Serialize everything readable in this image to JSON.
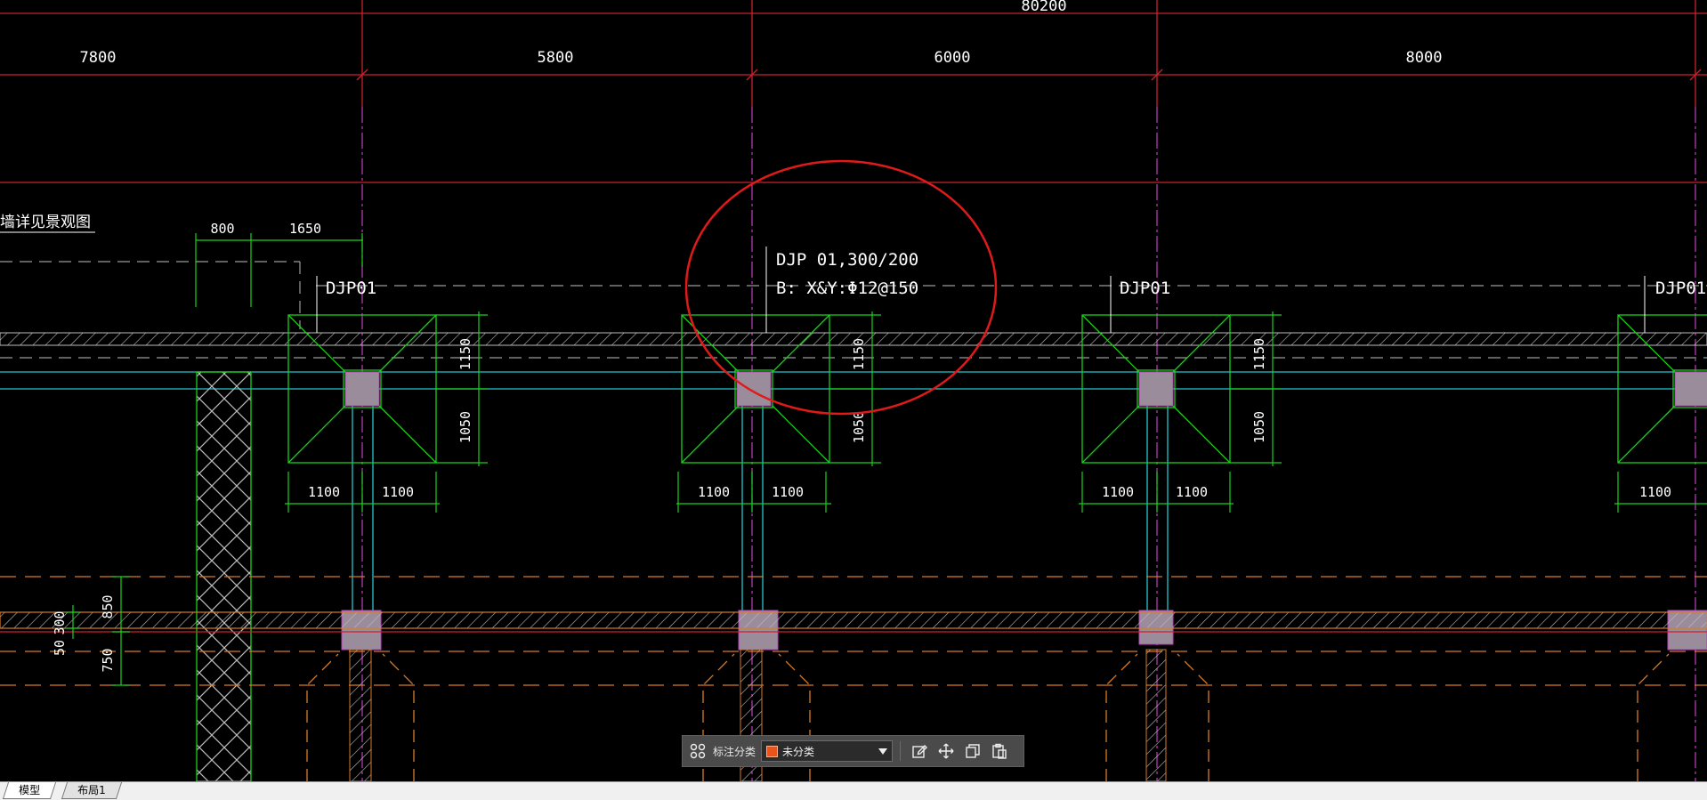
{
  "drawing": {
    "overall_dim": "80200",
    "bay_dims": [
      "7800",
      "5800",
      "6000",
      "8000"
    ],
    "note_text": "墙详见景观图",
    "top_dims": [
      "800",
      "1650"
    ],
    "footing_label": "DJP01",
    "footing_dims": {
      "upper": "1150",
      "lower": "1050",
      "left": "1100",
      "right": "1100"
    },
    "left_dims": [
      "850",
      "300",
      "50",
      "750"
    ],
    "callout_line1": "DJP 01,300/200",
    "callout_line2": "B: X&Y:Φ12@150",
    "colors": {
      "axis": "#c8232c",
      "green": "#19d219",
      "cyan": "#22c8d0",
      "orange": "#d87a28",
      "magenta": "#c040c0",
      "column": "#9a8c9a"
    }
  },
  "toolbar": {
    "grid_icon": "grid-icon",
    "category_label": "标注分类",
    "category_value": "未分类",
    "edit_icon": "edit-icon",
    "move_icon": "move-icon",
    "copy_icon": "copy-icon",
    "paste_icon": "paste-icon"
  },
  "tabs": {
    "model": "模型",
    "layout1": "布局1"
  }
}
